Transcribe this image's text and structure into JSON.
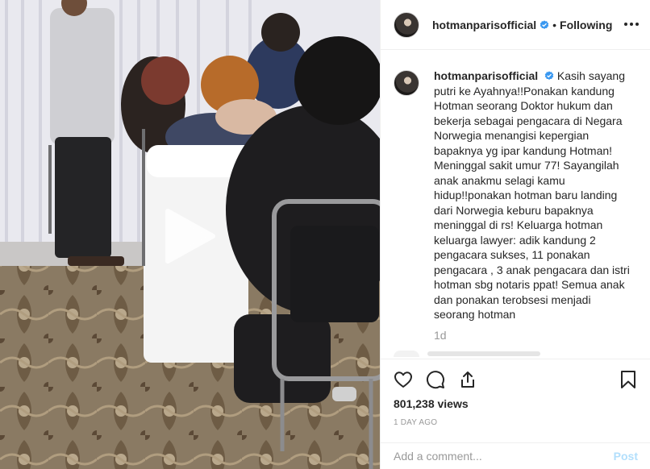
{
  "post": {
    "username": "hotmanparisofficial",
    "header_dot": "•",
    "follow_status": "Following",
    "caption": "Kasih sayang putri ke Ayahnya!!Ponakan kandung Hotman seorang Doktor hukum dan bekerja sebagai pengacara di Negara Norwegia menangisi kepergian bapaknya yg ipar kandung Hotman! Meninggal sakit umur 77! Sayangilah anak anakmu selagi kamu hidup!!ponakan hotman baru landing dari Norwegia keburu bapaknya meninggal di rs! Keluarga hotman keluarga lawyer: adik kandung 2 pengacara sukses, 11 ponakan pengacara , 3 anak pengacara dan istri hotman sbg notaris ppat! Semua anak dan ponakan terobsesi menjadi seorang hotman",
    "caption_time": "1d",
    "views": "801,238 views",
    "date": "1 DAY AGO"
  },
  "comment_box": {
    "placeholder": "Add a comment...",
    "post_label": "Post"
  },
  "icons": {
    "like": "heart-icon",
    "comment": "comment-icon",
    "share": "share-icon",
    "save": "bookmark-icon",
    "more": "more-options-icon",
    "play": "play-icon",
    "verified": "verified-badge-icon"
  },
  "colors": {
    "verified_blue": "#3897f0",
    "post_disabled": "#b2dffc",
    "muted_text": "#999999",
    "text": "#262626"
  }
}
